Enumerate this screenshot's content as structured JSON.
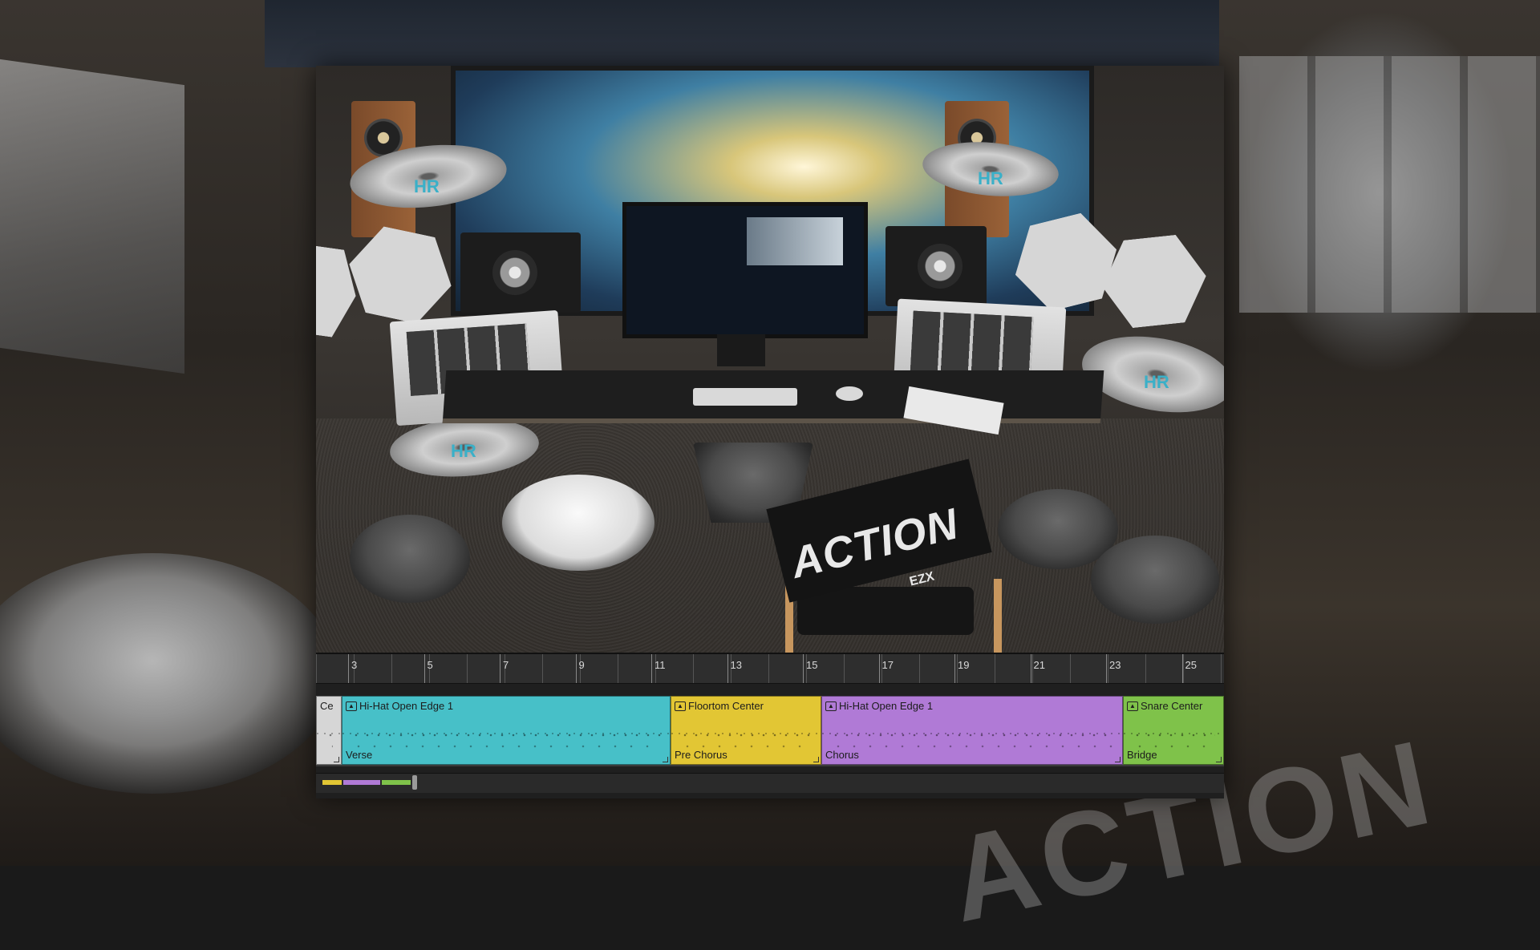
{
  "scene": {
    "cymbal_brand": "HR",
    "chair_text": "ACTION",
    "chair_subtext": "EZX"
  },
  "timeline": {
    "ruler_ticks": [
      "3",
      "5",
      "7",
      "9",
      "11",
      "13",
      "15",
      "17",
      "19",
      "21",
      "23",
      "25"
    ],
    "clips": [
      {
        "name": "Ce",
        "section": "",
        "color": "#d6d6d6"
      },
      {
        "name": "Hi-Hat Open Edge 1",
        "section": "Verse",
        "color": "#47c0c8"
      },
      {
        "name": "Floortom Center",
        "section": "Pre Chorus",
        "color": "#e2c634"
      },
      {
        "name": "Hi-Hat Open Edge 1",
        "section": "Chorus",
        "color": "#b07ad6"
      },
      {
        "name": "Snare Center",
        "section": "Bridge",
        "color": "#7fc24a"
      }
    ],
    "overview_colors": [
      "#e2c634",
      "#b07ad6",
      "#7fc24a"
    ]
  }
}
